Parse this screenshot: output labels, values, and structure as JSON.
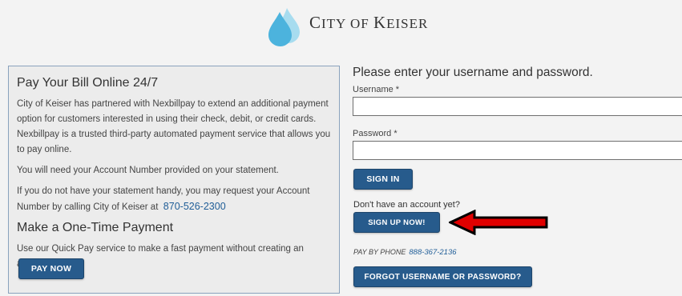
{
  "brand": {
    "name_part1": "C",
    "name_part2": "ITY OF ",
    "name_part3": "K",
    "name_part4": "EISER",
    "accent": "#5bb6dd"
  },
  "info": {
    "heading1": "Pay Your Bill Online 24/7",
    "para1": "City of Keiser has partnered with Nexbillpay to extend an additional payment option for customers interested in using their check, debit, or credit cards. Nexbillpay is a trusted third-party automated payment service that allows you to pay online.",
    "para2": "You will need your Account Number provided on your statement.",
    "para3": "If you do not have your statement handy, you may request your Account Number by calling City of Keiser at",
    "phone": "870-526-2300",
    "heading2": "Make a One-Time Payment",
    "para4": "Use our Quick Pay service to make a fast payment without creating an account.",
    "pay_now_label": "PAY NOW"
  },
  "login": {
    "title": "Please enter your username and password.",
    "username_label": "Username *",
    "username_value": "",
    "password_label": "Password *",
    "password_value": "",
    "sign_in_label": "SIGN IN",
    "no_account_text": "Don't have an account yet?",
    "sign_up_label": "SIGN UP NOW!",
    "pay_by_phone_label": "PAY BY PHONE",
    "pay_by_phone_number": "888-367-2136",
    "forgot_label": "FORGOT USERNAME OR PASSWORD?"
  },
  "colors": {
    "button": "#275b8c",
    "link": "#1f5d97",
    "arrow": "#e00000"
  }
}
